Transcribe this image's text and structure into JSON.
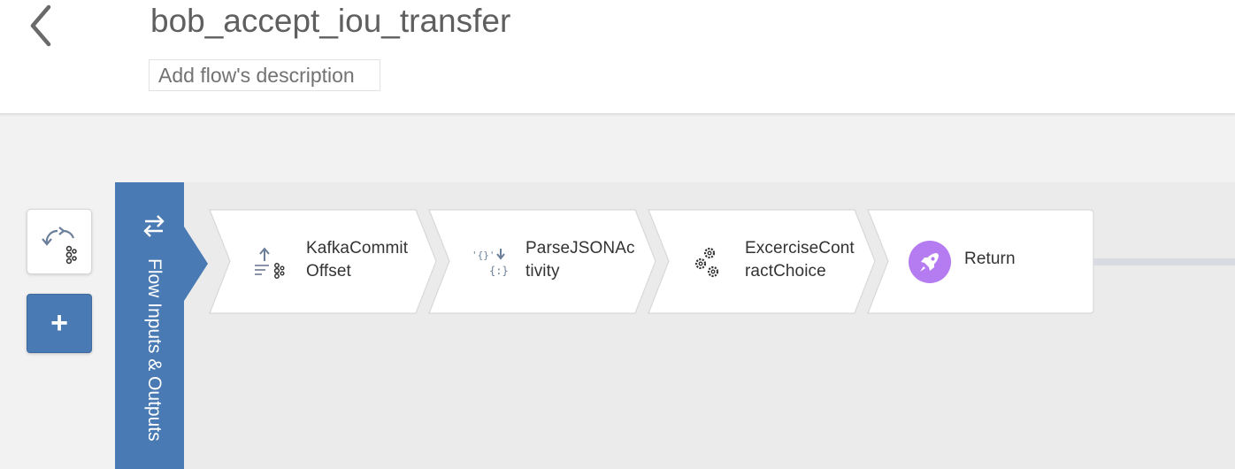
{
  "header": {
    "back_icon": "chevron-left-icon",
    "title": "bob_accept_iou_transfer",
    "description_placeholder": "Add flow's description"
  },
  "sidebar": {
    "trigger_icon": "kafka-trigger-icon",
    "add_label": "+"
  },
  "flow_inputs": {
    "label": "Flow Inputs & Outputs",
    "icon": "swap-arrows-icon"
  },
  "tiles": [
    {
      "label": "KafkaCommitOffset",
      "icon": "kafka-commit-icon"
    },
    {
      "label": "ParseJSONActivity",
      "icon": "json-parse-icon"
    },
    {
      "label": "ExcerciseContractChoice",
      "icon": "gears-icon"
    },
    {
      "label": "Return",
      "icon": "rocket-icon"
    }
  ],
  "colors": {
    "accent_blue": "#4a7ab3",
    "return_purple": "#b57bf0",
    "canvas": "#ebebeb"
  }
}
